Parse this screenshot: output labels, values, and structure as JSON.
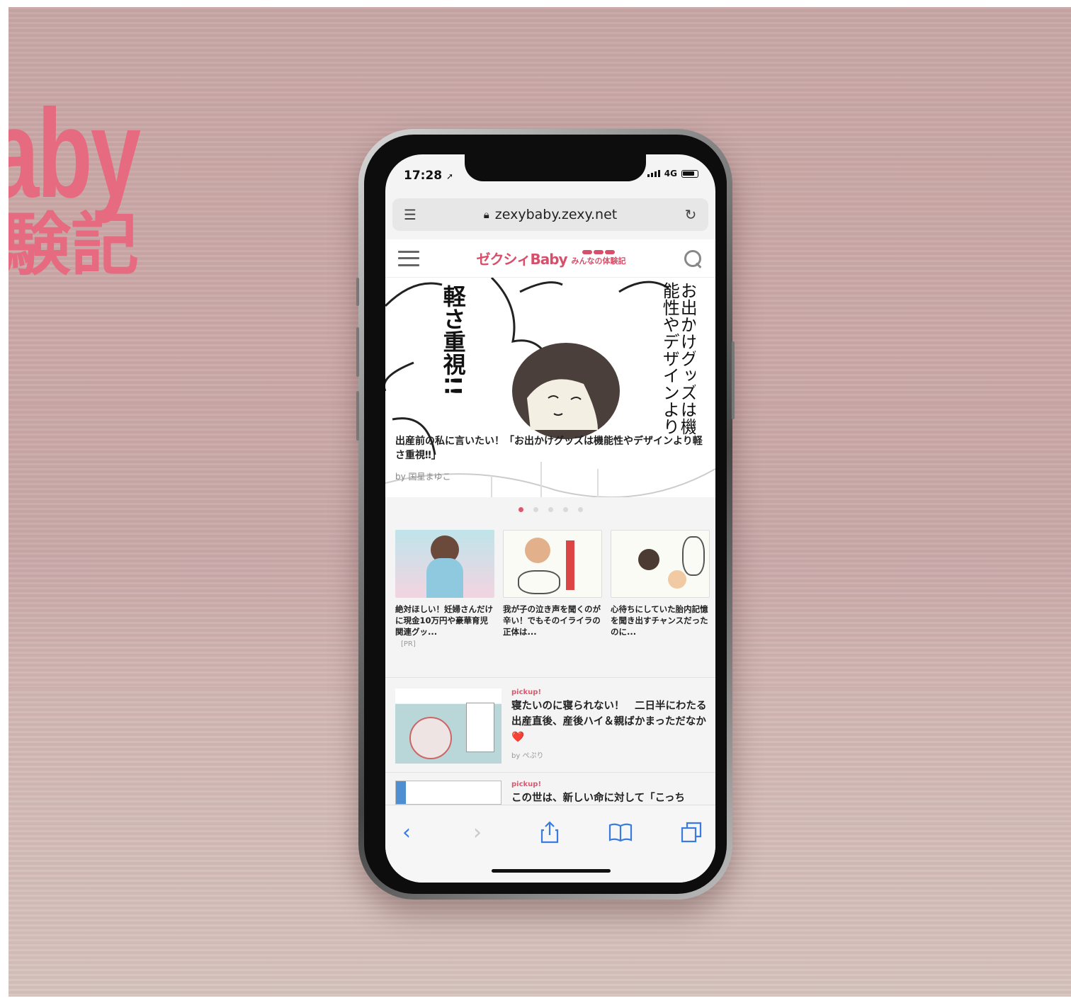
{
  "backdrop": {
    "brand_text": "aby",
    "brand_sub": "験記"
  },
  "status": {
    "time": "17:28",
    "network": "4G"
  },
  "browser": {
    "url": "zexybaby.zexy.net"
  },
  "site": {
    "logo_main": "ゼクシィBaby",
    "logo_sub": "みんなの体験記"
  },
  "hero": {
    "art_text_left": "軽さ重視!!",
    "art_text_right": "お出かけグッズは機能性やデザインより",
    "caption": "出産前の私に言いたい！「お出かけグッズは機能性やデザインより軽さ重視‼」",
    "author": "by 国星まゆこ",
    "slides_total": 5,
    "active_slide": 0
  },
  "cards": [
    {
      "title": "絶対ほしい！妊婦さんだけに現金10万円や豪華育児関連グッ...",
      "pr": "[PR]"
    },
    {
      "title": "我が子の泣き声を聞くのが辛い！でもそのイライラの正体は...",
      "pr": ""
    },
    {
      "title": "心待ちにしていた胎内記憶を聞き出すチャンスだったのに...",
      "pr": ""
    }
  ],
  "pickups": [
    {
      "label": "pickup!",
      "title": "寝たいのに寝られない！　二日半にわたる出産直後、産後ハイ＆親ばかまっただなか❤️",
      "author": "by ぺぷり"
    },
    {
      "label": "pickup!",
      "title": "この世は、新しい命に対して「こっち",
      "author": ""
    }
  ],
  "colors": {
    "accent": "#e0566e",
    "brand": "#d74f6a",
    "link_blue": "#3a7be0"
  }
}
